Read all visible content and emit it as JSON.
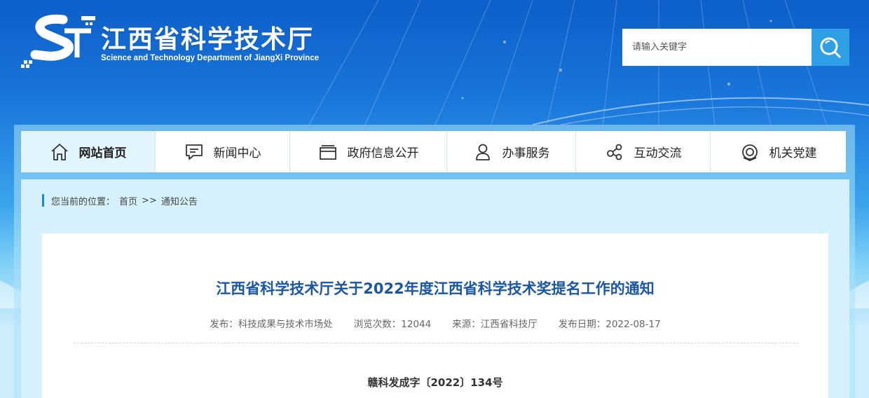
{
  "header": {
    "title": "江西省科学技术厅",
    "subtitle": "Science and Technology Department of JiangXi Province",
    "logo_icon": "ST-logo-icon",
    "search": {
      "placeholder": "请输入关键字",
      "value": "",
      "button_icon": "search-icon"
    }
  },
  "nav": {
    "items": [
      {
        "label": "网站首页",
        "icon": "home-icon",
        "active": true
      },
      {
        "label": "新闻中心",
        "icon": "chat-icon",
        "active": false
      },
      {
        "label": "政府信息公开",
        "icon": "folder-icon",
        "active": false
      },
      {
        "label": "办事服务",
        "icon": "user-icon",
        "active": false
      },
      {
        "label": "互动交流",
        "icon": "share-icon",
        "active": false
      },
      {
        "label": "机关党建",
        "icon": "party-icon",
        "active": false
      }
    ]
  },
  "breadcrumb": {
    "prefix": "您当前的位置：",
    "home": "首页",
    "separator": ">>",
    "current": "通知公告"
  },
  "article": {
    "title": "江西省科学技术厅关于2022年度江西省科学技术奖提名工作的通知",
    "publisher": "发布：科技成果与技术市场处",
    "views": "浏览次数：12044",
    "source": "来源：江西省科技厅",
    "date": "发布日期：2022-08-17",
    "doc_number": "赣科发成字〔2022〕134号"
  },
  "colors": {
    "banner_top": "#0d5fc9",
    "accent": "#2fa0e6",
    "title_blue": "#1a56a6",
    "page_bg": "#cfeefb"
  }
}
